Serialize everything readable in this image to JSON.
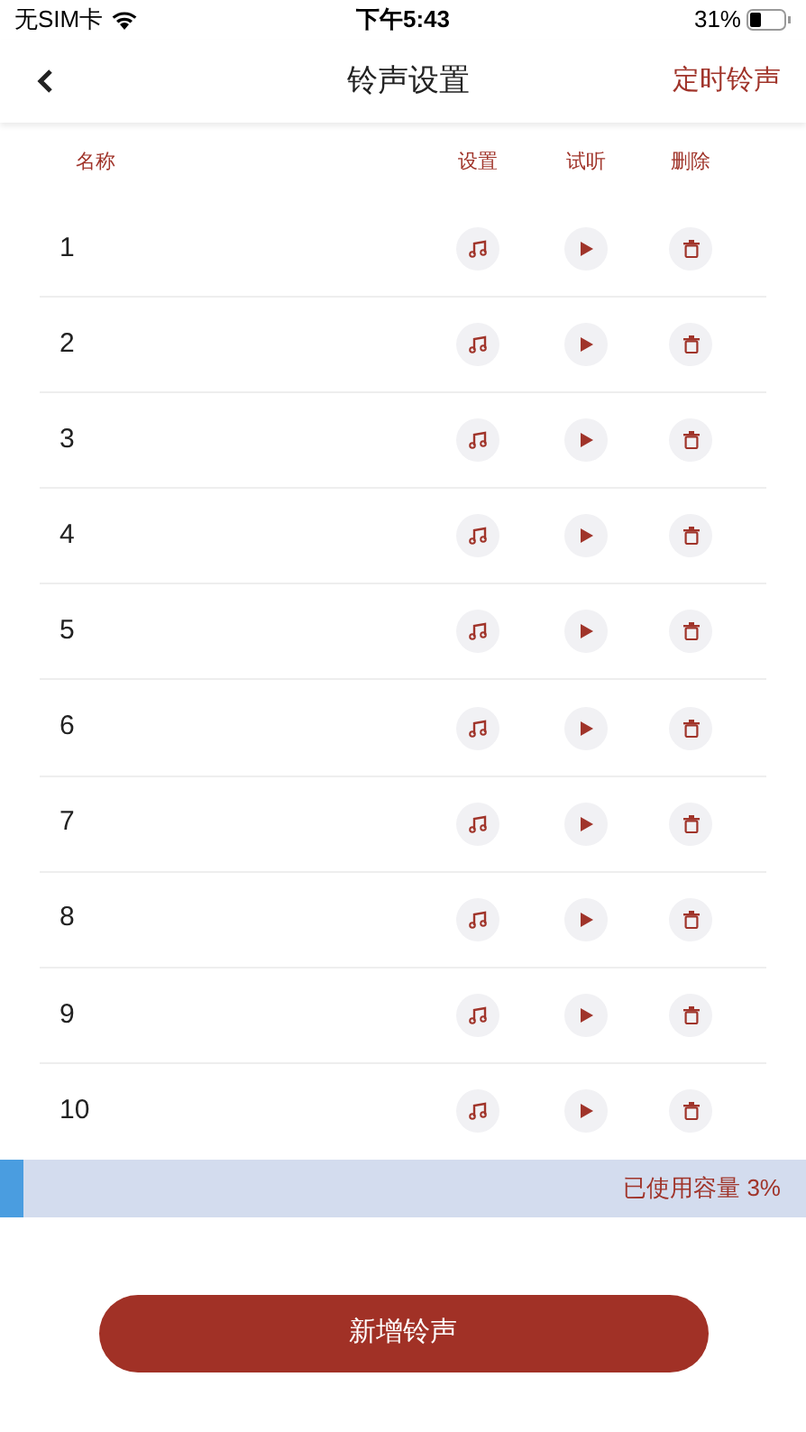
{
  "status_bar": {
    "carrier": "无SIM卡",
    "time": "下午5:43",
    "battery": "31%"
  },
  "nav": {
    "title": "铃声设置",
    "action": "定时铃声"
  },
  "table": {
    "columns": [
      "名称",
      "设置",
      "试听",
      "删除"
    ],
    "rows": [
      "1",
      "2",
      "3",
      "4",
      "5",
      "6",
      "7",
      "8",
      "9",
      "10"
    ]
  },
  "capacity": {
    "level": 0.03,
    "label": "已使用容量 3%"
  },
  "add_button": "新增铃声"
}
